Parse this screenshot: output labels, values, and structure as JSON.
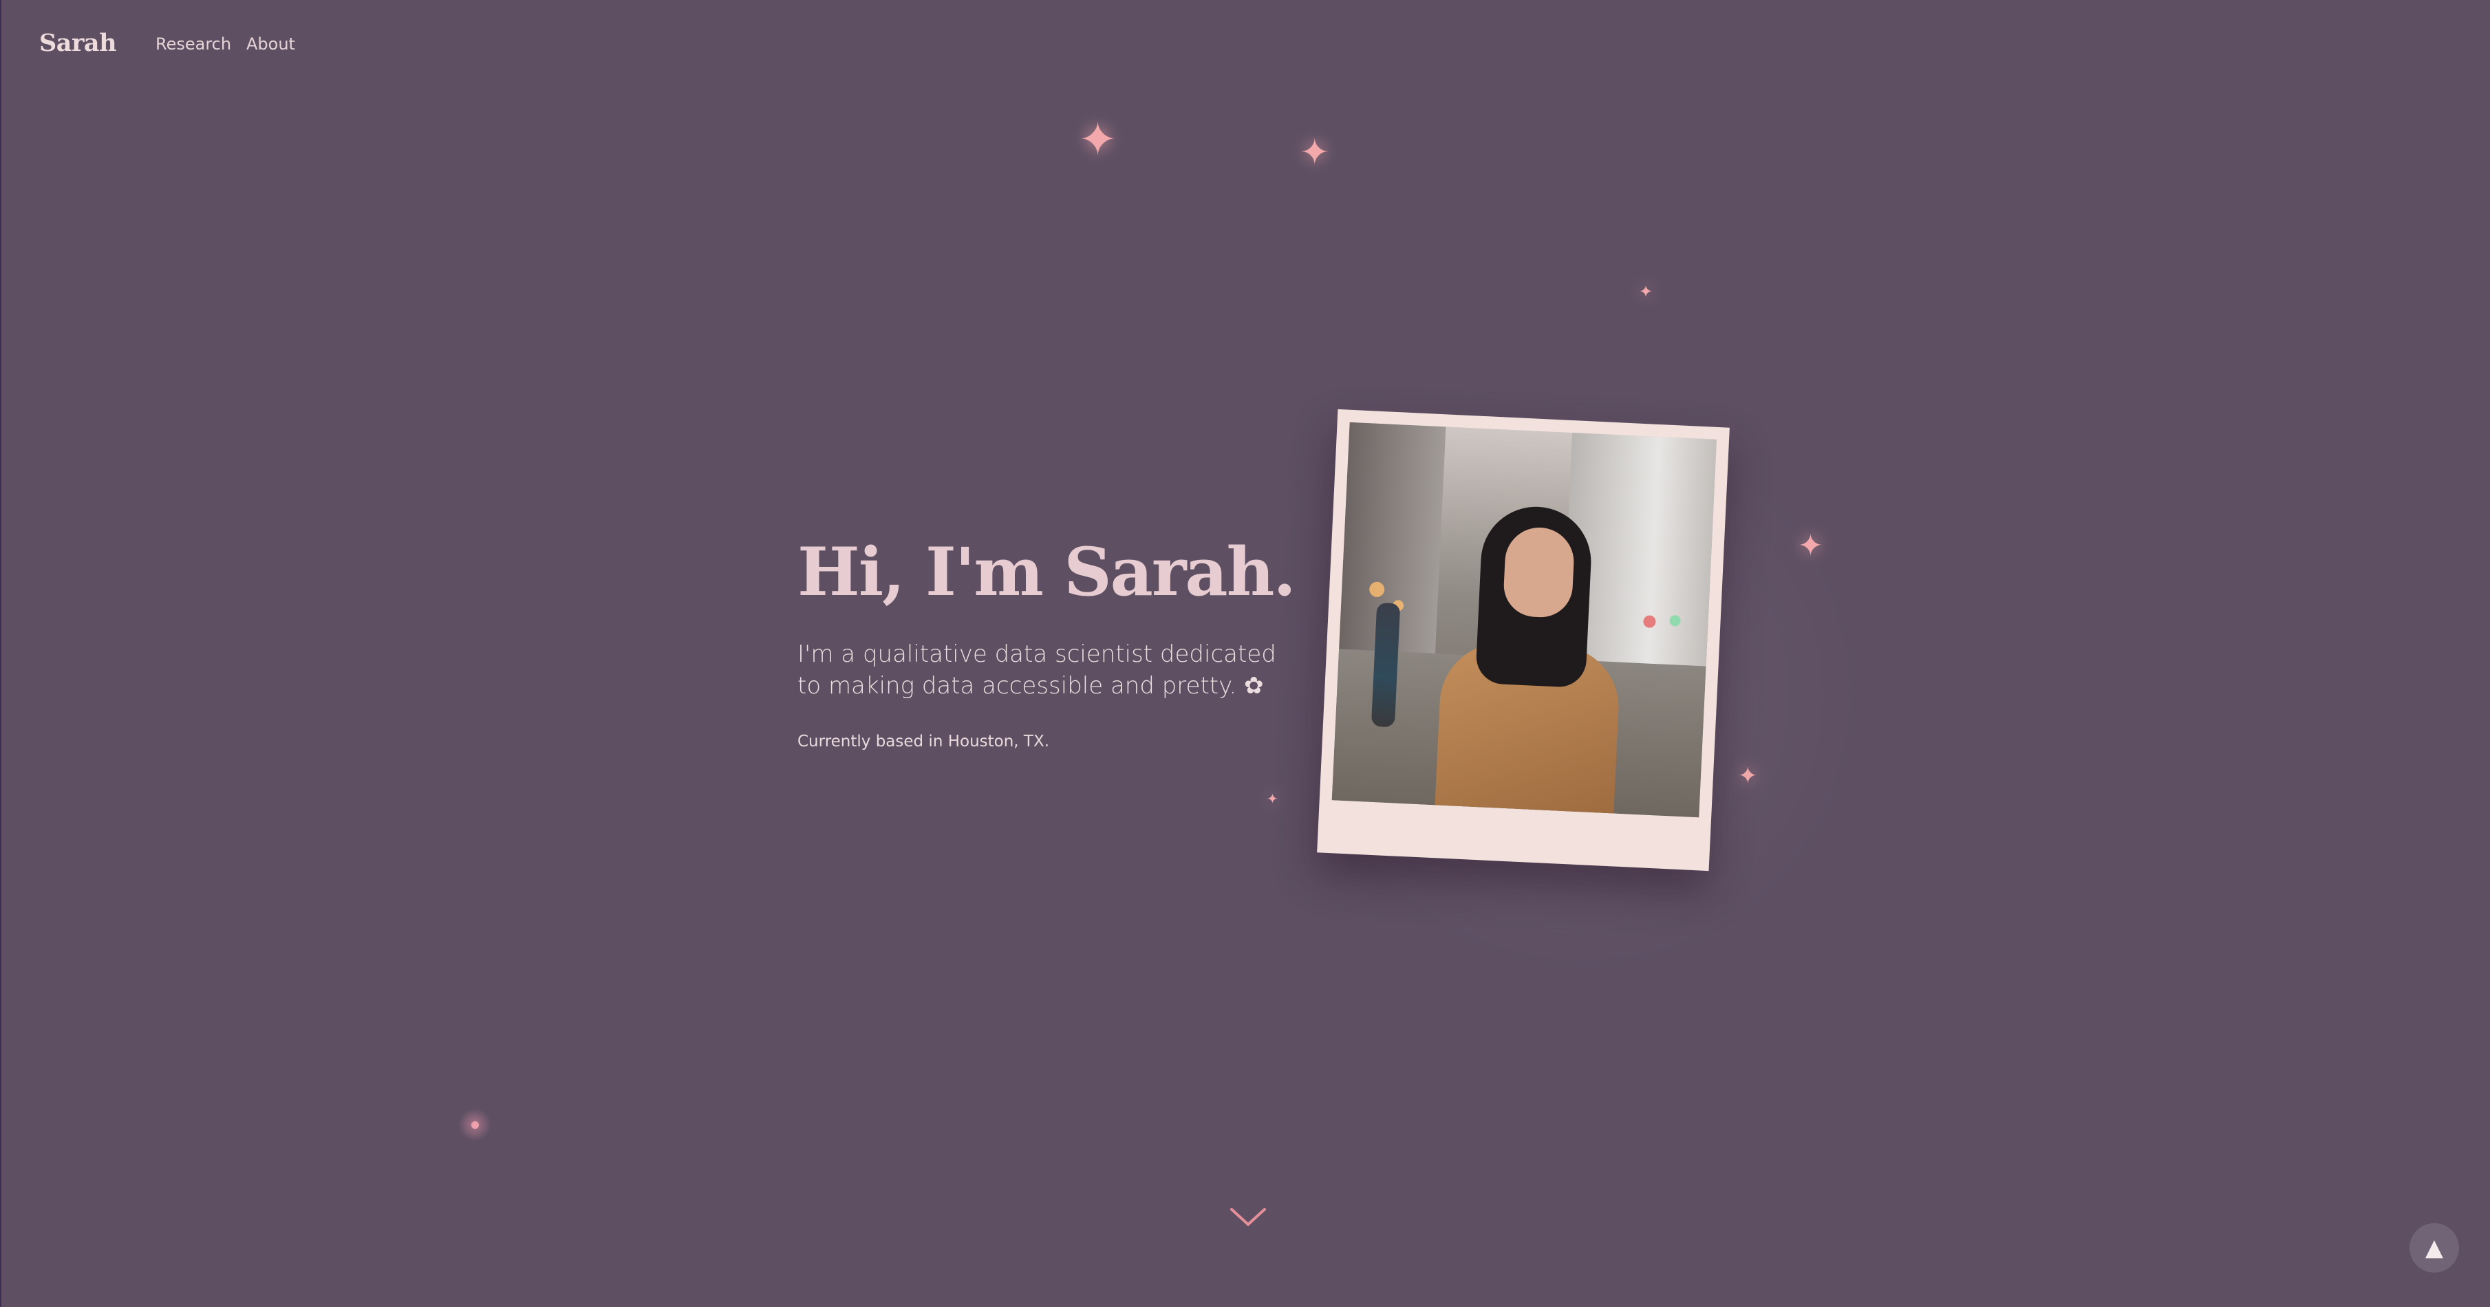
{
  "nav": {
    "brand": "Sarah",
    "links": [
      "Research",
      "About"
    ]
  },
  "hero": {
    "title": "Hi, I'm Sarah.",
    "subtitle_line1": "I'm a qualitative data scientist dedicated",
    "subtitle_line2": "to making data accessible and pretty. ✿",
    "location": "Currently based in Houston, TX."
  },
  "controls": {
    "scroll_down_icon": "chevron-down-icon",
    "back_to_top_icon": "arrow-up-icon",
    "back_to_top_glyph": "▲"
  },
  "decor": {
    "sparkle_glyph": "✦",
    "sparkle_color": "#f3a9ab",
    "background_color": "#5e4f63",
    "polaroid_color": "#f2e1dd",
    "title_color": "#e7cdd1"
  }
}
